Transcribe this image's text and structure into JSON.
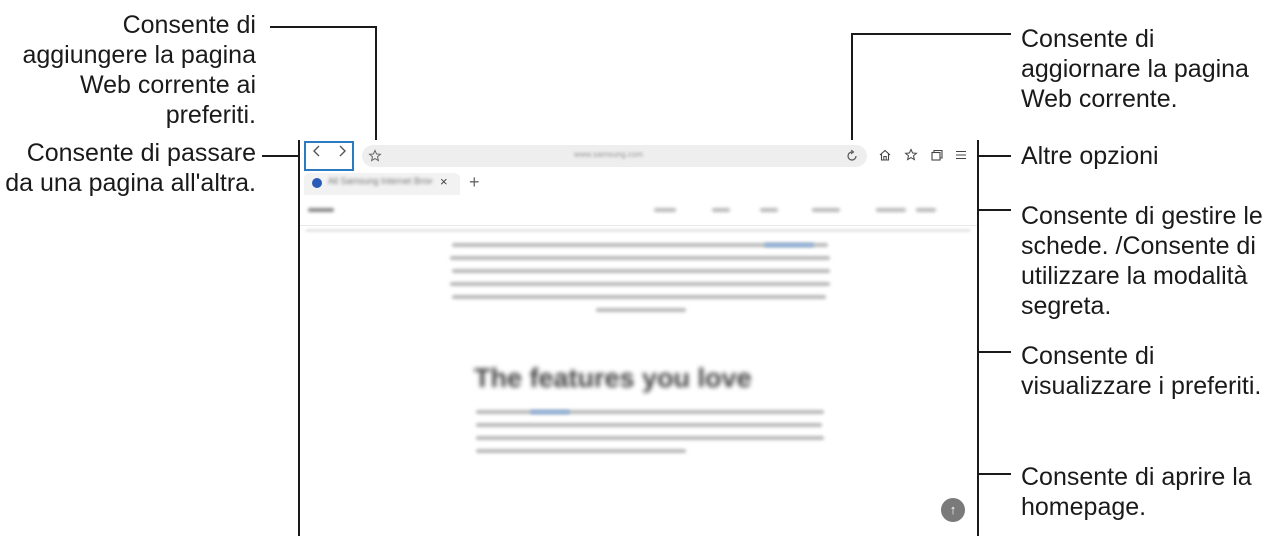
{
  "callouts": {
    "add_bookmark": "Consente di aggiungere la pagina Web corrente ai preferiti.",
    "back_forward": "Consente di passare da una pagina all'altra.",
    "refresh": "Consente di aggiornare la pagina Web corrente.",
    "more_options": "Altre opzioni",
    "tabs_secret": "Consente di gestire le schede. /Consente di utilizzare la modalità segreta.",
    "bookmarks": "Consente di visualizzare i preferiti.",
    "homepage": "Consente di aprire la homepage."
  },
  "browser": {
    "url": "www.samsung.com",
    "tab_title": "All Samsung Internet Browser",
    "tab_close": "×",
    "new_tab": "+",
    "scroll_top": "↑",
    "page_heading": "The features you love"
  },
  "icons": {
    "back": "chevron-left",
    "forward": "chevron-right",
    "bookmark_add": "star-outline",
    "refresh": "refresh",
    "home": "home",
    "bookmarks": "star-list",
    "tabs": "tabs",
    "menu": "hamburger"
  },
  "colors": {
    "highlight_box": "#2a7bbf",
    "leader_line": "#1a1a1a"
  }
}
